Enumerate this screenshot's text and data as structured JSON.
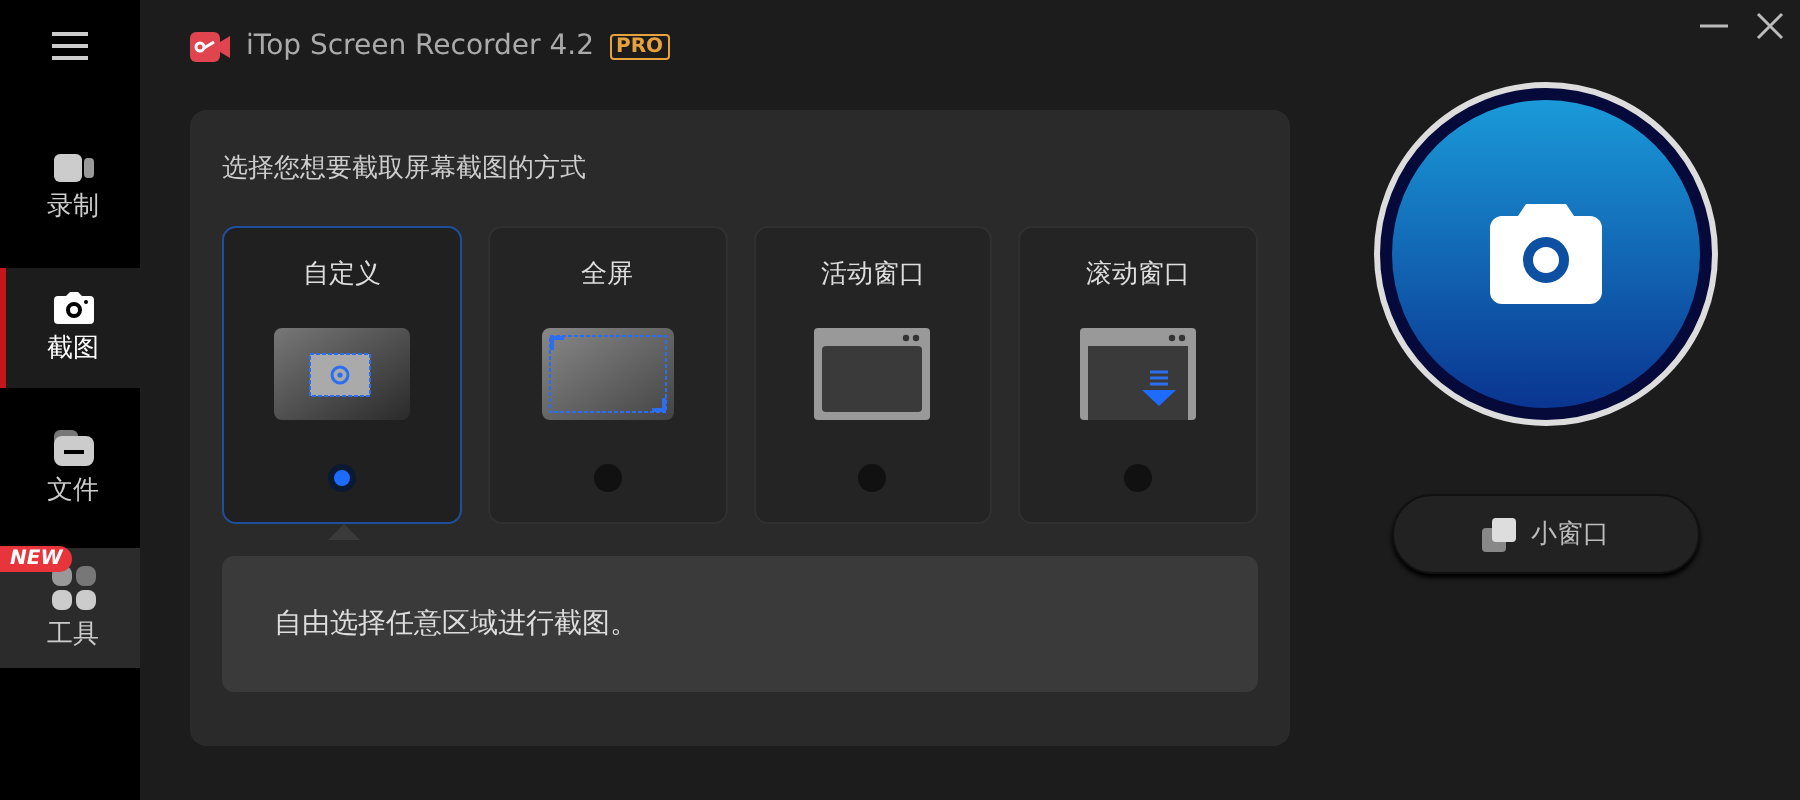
{
  "window": {
    "title": "iTop Screen Recorder 4.2",
    "edition_badge": "PRO"
  },
  "sidebar": {
    "items": [
      {
        "label": "录制",
        "kind": "record",
        "selected": false,
        "hovered": false
      },
      {
        "label": "截图",
        "kind": "screenshot",
        "selected": true,
        "hovered": false
      },
      {
        "label": "文件",
        "kind": "files",
        "selected": false,
        "hovered": false
      },
      {
        "label": "工具",
        "kind": "tools",
        "selected": false,
        "hovered": true,
        "badge": "NEW"
      }
    ]
  },
  "capture_panel": {
    "heading": "选择您想要截取屏幕截图的方式",
    "modes": [
      {
        "label": "自定义",
        "kind": "custom",
        "selected": true
      },
      {
        "label": "全屏",
        "kind": "fullscreen",
        "selected": false
      },
      {
        "label": "活动窗口",
        "kind": "window",
        "selected": false
      },
      {
        "label": "滚动窗口",
        "kind": "scrolling",
        "selected": false
      }
    ],
    "description": "自由选择任意区域进行截图。"
  },
  "mini_window_button": {
    "label": "小窗口"
  }
}
